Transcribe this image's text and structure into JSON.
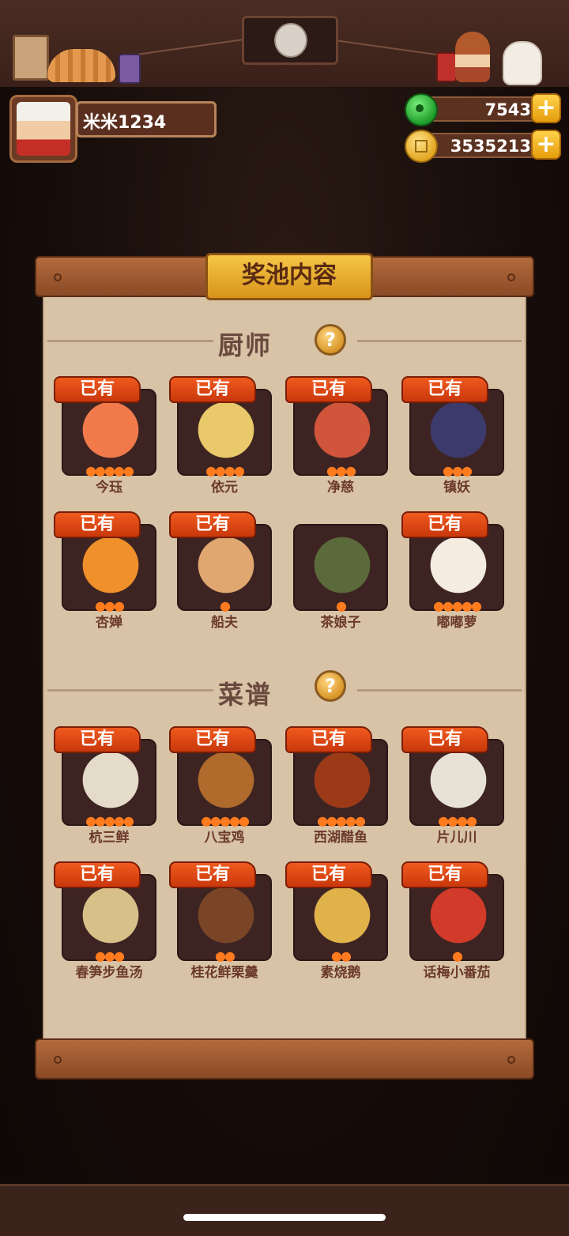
{
  "player": {
    "name": "米米1234"
  },
  "currency": [
    {
      "icon": "jade-icon",
      "value": "7543"
    },
    {
      "icon": "coin-icon",
      "value": "3535213"
    }
  ],
  "panel": {
    "title": "奖池内容"
  },
  "sections": {
    "chefs": {
      "label": "厨师"
    },
    "recipes": {
      "label": "菜谱"
    }
  },
  "owned_label": "已有",
  "chefs": [
    {
      "name": "今珏",
      "owned": true,
      "stars": 5,
      "color": "#f07a4a"
    },
    {
      "name": "依元",
      "owned": true,
      "stars": 4,
      "color": "#e9c96a"
    },
    {
      "name": "净慈",
      "owned": true,
      "stars": 3,
      "color": "#d0553a"
    },
    {
      "name": "镇妖",
      "owned": true,
      "stars": 3,
      "color": "#3c3a6b"
    },
    {
      "name": "杏婵",
      "owned": true,
      "stars": 3,
      "color": "#f0902a"
    },
    {
      "name": "船夫",
      "owned": true,
      "stars": 1,
      "color": "#e0a870"
    },
    {
      "name": "茶娘子",
      "owned": false,
      "stars": 1,
      "color": "#5a6a3a"
    },
    {
      "name": "嘟嘟萝",
      "owned": true,
      "stars": 5,
      "color": "#f4ece0"
    }
  ],
  "recipes": [
    {
      "name": "杭三鲜",
      "owned": true,
      "stars": 5,
      "color": "#e4dbc8"
    },
    {
      "name": "八宝鸡",
      "owned": true,
      "stars": 5,
      "color": "#b06a2c"
    },
    {
      "name": "西湖醋鱼",
      "owned": true,
      "stars": 5,
      "color": "#9c3a18"
    },
    {
      "name": "片儿川",
      "owned": true,
      "stars": 4,
      "color": "#e8e2d6"
    },
    {
      "name": "春笋步鱼汤",
      "owned": true,
      "stars": 3,
      "color": "#d8c089"
    },
    {
      "name": "桂花鲜栗羹",
      "owned": true,
      "stars": 2,
      "color": "#7a4526"
    },
    {
      "name": "素烧鹅",
      "owned": true,
      "stars": 2,
      "color": "#e0b24a"
    },
    {
      "name": "话梅小番茄",
      "owned": true,
      "stars": 1,
      "color": "#d23a2a"
    }
  ]
}
